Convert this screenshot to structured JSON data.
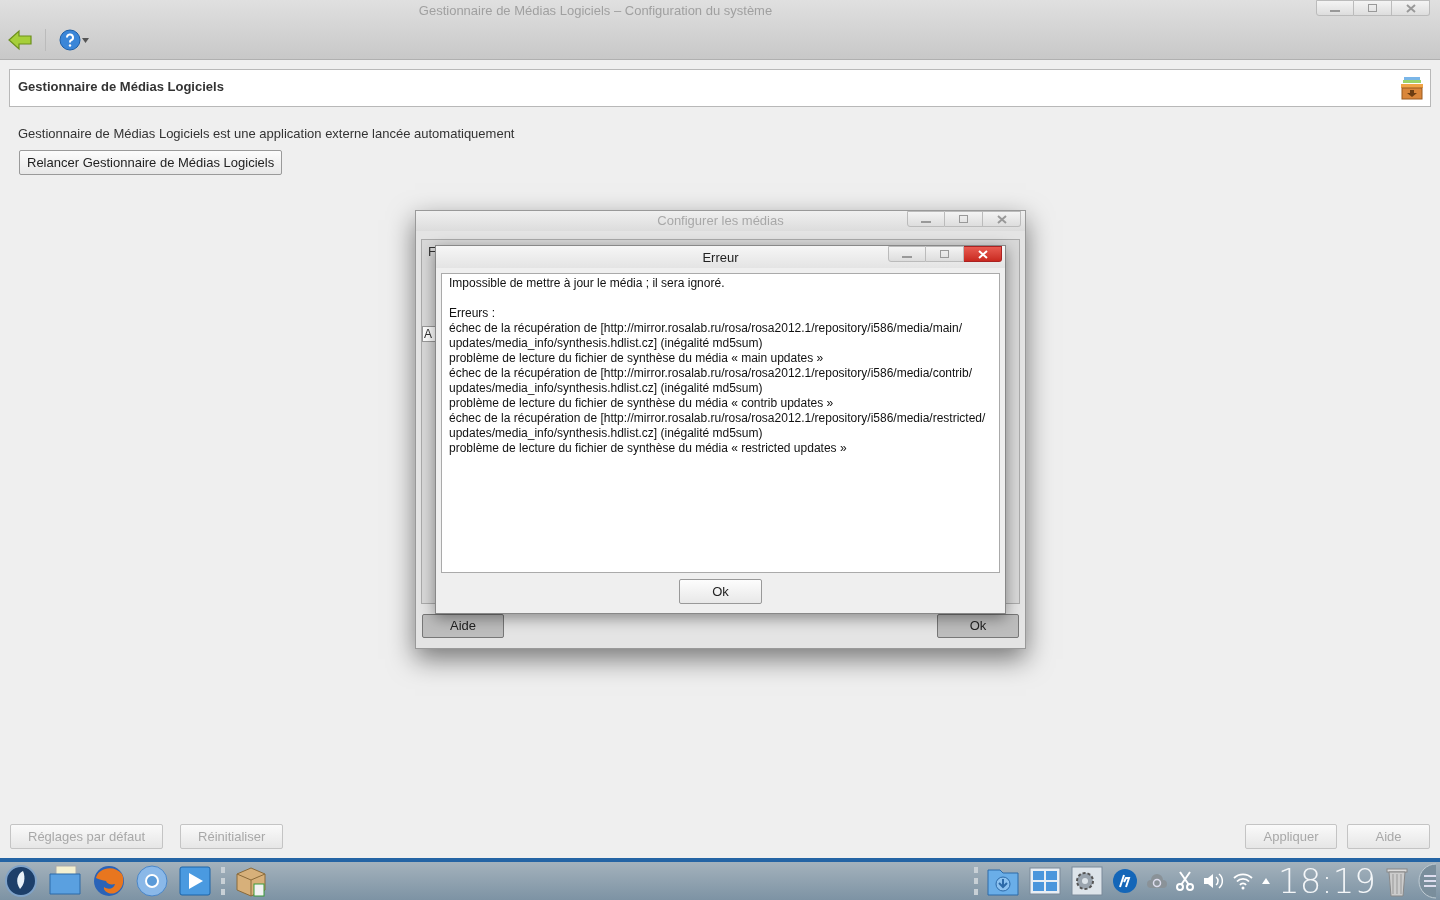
{
  "window": {
    "title": "Gestionnaire de Médias Logiciels – Configuration du système"
  },
  "header": {
    "title": "Gestionnaire de Médias Logiciels"
  },
  "info_text": "Gestionnaire de Médias Logiciels est une application externe lancée automatiquement",
  "relaunch_button": "Relancer Gestionnaire de Médias Logiciels",
  "media_window": {
    "title": "Configurer les médias",
    "menu_fragment": "F",
    "column_fragment": "A",
    "buttons": [
      "Aide",
      "Ok"
    ]
  },
  "error_dialog": {
    "title": "Erreur",
    "summary": "Impossible de mettre à jour le média ; il sera ignoré.",
    "errors_heading": "Erreurs :",
    "errors": [
      "échec de la récupération de [http://mirror.rosalab.ru/rosa/rosa2012.1/repository/i586/media/main/updates/media_info/synthesis.hdlist.cz] (inégalité md5sum)",
      "problème de lecture du fichier de synthèse du média « main updates »",
      "échec de la récupération de [http://mirror.rosalab.ru/rosa/rosa2012.1/repository/i586/media/contrib/updates/media_info/synthesis.hdlist.cz] (inégalité md5sum)",
      "problème de lecture du fichier de synthèse du média « contrib updates »",
      "échec de la récupération de [http://mirror.rosalab.ru/rosa/rosa2012.1/repository/i586/media/restricted/updates/media_info/synthesis.hdlist.cz] (inégalité md5sum)",
      "problème de lecture du fichier de synthèse du média « restricted updates »"
    ],
    "button": "Ok"
  },
  "footer_left": [
    {
      "label": "Réglages par défaut",
      "disabled": true
    },
    {
      "label": "Réinitialiser",
      "disabled": true
    }
  ],
  "footer_right": [
    {
      "label": "Appliquer",
      "disabled": true
    },
    {
      "label": "Aide",
      "disabled": true
    }
  ],
  "taskbar": {
    "clock": "18:19"
  }
}
